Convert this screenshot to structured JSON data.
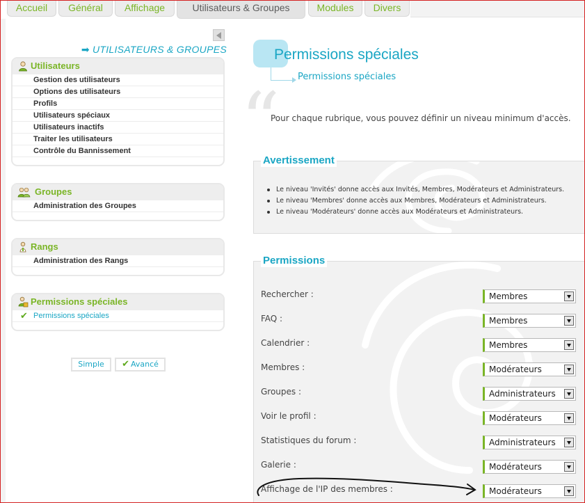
{
  "tabs": [
    {
      "label": "Accueil",
      "active": false
    },
    {
      "label": "Général",
      "active": false
    },
    {
      "label": "Affichage",
      "active": false
    },
    {
      "label": "Utilisateurs & Groupes",
      "active": true
    },
    {
      "label": "Modules",
      "active": false
    },
    {
      "label": "Divers",
      "active": false
    }
  ],
  "sidebar": {
    "heading": "UTILISATEURS & GROUPES",
    "heading_arrow": "➡",
    "sections": [
      {
        "title": "Utilisateurs",
        "icon": "user-icon",
        "items": [
          "Gestion des utilisateurs",
          "Options des utilisateurs",
          "Profils",
          "Utilisateurs spéciaux",
          "Utilisateurs inactifs",
          "Traiter les utilisateurs",
          "Contrôle du Bannissement"
        ]
      },
      {
        "title": "Groupes",
        "icon": "group-icon",
        "items": [
          "Administration des Groupes"
        ]
      },
      {
        "title": "Rangs",
        "icon": "rank-icon",
        "items": [
          "Administration des Rangs"
        ]
      },
      {
        "title": "Permissions spéciales",
        "icon": "lock-user-icon",
        "items": [
          "Permissions spéciales"
        ],
        "selected_item": "Permissions spéciales"
      }
    ],
    "mode_buttons": {
      "simple": "Simple",
      "advanced": "Avancé",
      "checkmark": "✔"
    }
  },
  "main": {
    "title": "Permissions spéciales",
    "subtitle": "Permissions spéciales",
    "quote_glyph": "“",
    "intro": "Pour chaque rubrique, vous pouvez définir un niveau minimum d'accès.",
    "warning": {
      "legend": "Avertissement",
      "items": [
        "Le niveau 'Invités' donne accès aux Invités, Membres, Modérateurs et Administrateurs.",
        "Le niveau 'Membres' donne accès aux Membres, Modérateurs et Administrateurs.",
        "Le niveau 'Modérateurs' donne accès aux Modérateurs et Administrateurs."
      ]
    },
    "permissions": {
      "legend": "Permissions",
      "rows": [
        {
          "label": "Rechercher :",
          "value": "Membres"
        },
        {
          "label": "FAQ :",
          "value": "Membres"
        },
        {
          "label": "Calendrier :",
          "value": "Membres"
        },
        {
          "label": "Membres :",
          "value": "Modérateurs"
        },
        {
          "label": "Groupes :",
          "value": "Administrateurs"
        },
        {
          "label": "Voir le profil :",
          "value": "Modérateurs"
        },
        {
          "label": "Statistiques du forum :",
          "value": "Administrateurs"
        },
        {
          "label": "Galerie :",
          "value": "Modérateurs"
        },
        {
          "label": "Affichage de l'IP des membres :",
          "value": "Modérateurs"
        }
      ]
    }
  },
  "colors": {
    "accent_green": "#7ab526",
    "accent_blue": "#1aa6c4",
    "annotation_ink": "#111111",
    "frame_red": "#d42020"
  }
}
